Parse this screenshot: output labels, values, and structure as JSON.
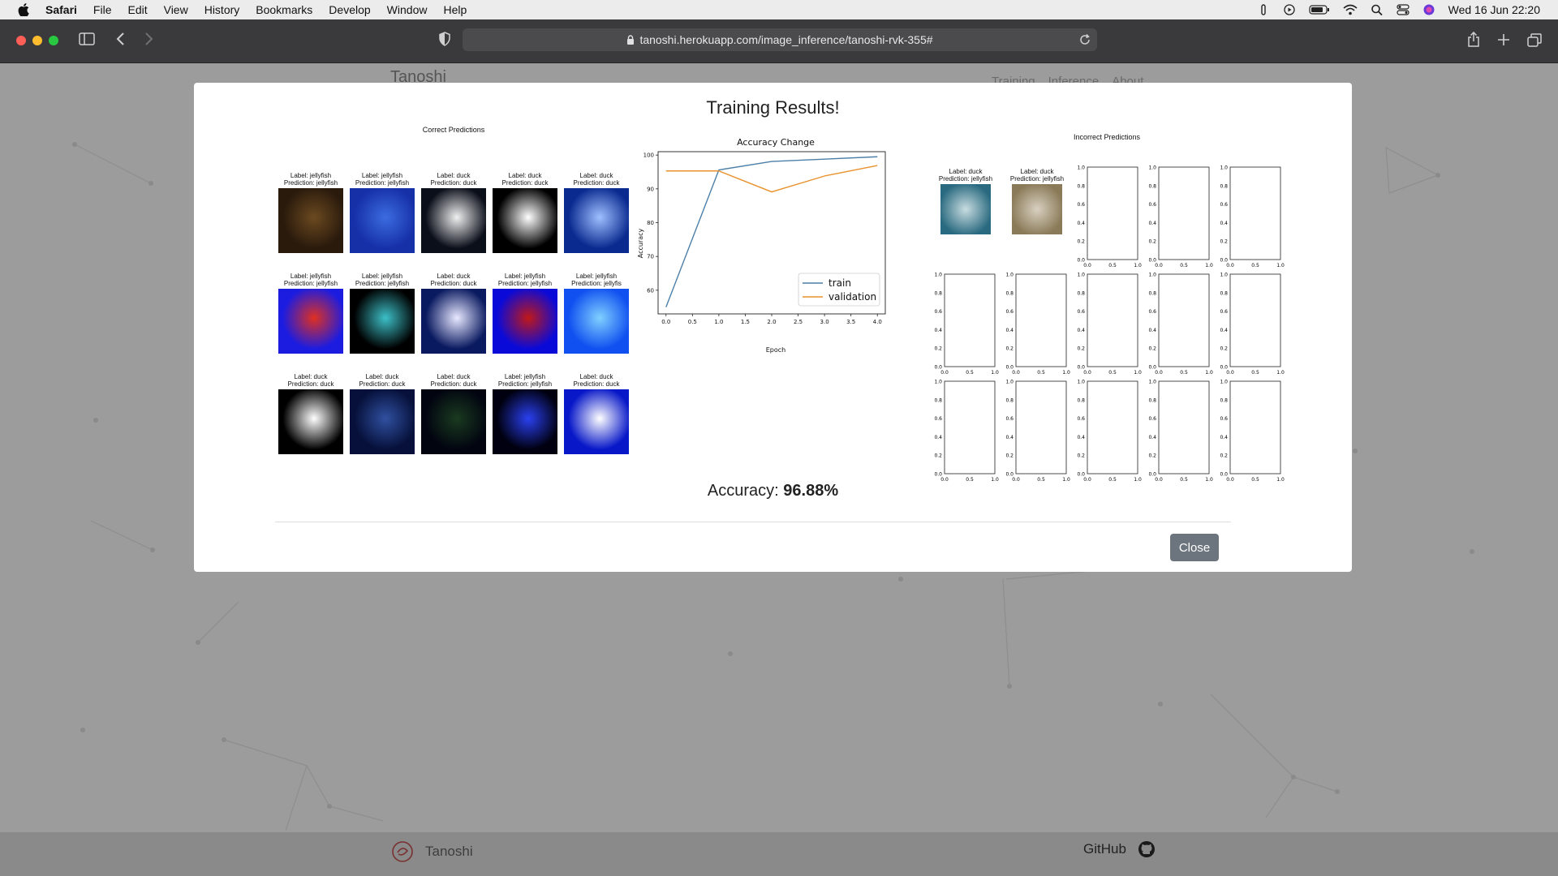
{
  "menubar": {
    "app": "Safari",
    "items": [
      "File",
      "Edit",
      "View",
      "History",
      "Bookmarks",
      "Develop",
      "Window",
      "Help"
    ],
    "datetime": "Wed 16 Jun  22:20"
  },
  "browser": {
    "url": "tanoshi.herokuapp.com/image_inference/tanoshi-rvk-355#"
  },
  "site": {
    "brand": "Tanoshi",
    "nav": [
      "Training",
      "Inference",
      "About"
    ],
    "footer_brand": "Tanoshi",
    "footer_github": "GitHub"
  },
  "modal": {
    "title": "Training Results!",
    "accuracy_label": "Accuracy:",
    "accuracy_value": "96.88%",
    "close_label": "Close"
  },
  "correct_panel": {
    "title": "Correct Predictions",
    "items": [
      {
        "label": "Label: jellyfish",
        "pred": "Prediction: jellyfish",
        "colors": [
          "#2a1a0c",
          "#6b4a20"
        ]
      },
      {
        "label": "Label: jellyfish",
        "pred": "Prediction: jellyfish",
        "colors": [
          "#1630a8",
          "#3c6ce0"
        ]
      },
      {
        "label": "Label: duck",
        "pred": "Prediction: duck",
        "colors": [
          "#0b0f1a",
          "#f0f0f0"
        ]
      },
      {
        "label": "Label: duck",
        "pred": "Prediction: duck",
        "colors": [
          "#000000",
          "#ffffff"
        ]
      },
      {
        "label": "Label: duck",
        "pred": "Prediction: duck",
        "colors": [
          "#0a2a90",
          "#9fc0ff"
        ]
      },
      {
        "label": "Label: jellyfish",
        "pred": "Prediction: jellyfish",
        "colors": [
          "#1c1ce0",
          "#e03020"
        ]
      },
      {
        "label": "Label: jellyfish",
        "pred": "Prediction: jellyfish",
        "colors": [
          "#000000",
          "#3cc0c8"
        ]
      },
      {
        "label": "Label: duck",
        "pred": "Prediction: duck",
        "colors": [
          "#0a1a60",
          "#e8e8ff"
        ]
      },
      {
        "label": "Label: jellyfish",
        "pred": "Prediction: jellyfish",
        "colors": [
          "#0a0ad8",
          "#c01818"
        ]
      },
      {
        "label": "Label: jellyfish",
        "pred": "Prediction: jellyfis",
        "colors": [
          "#1050f0",
          "#80d0ff"
        ]
      },
      {
        "label": "Label: duck",
        "pred": "Prediction: duck",
        "colors": [
          "#000000",
          "#ffffff"
        ]
      },
      {
        "label": "Label: duck",
        "pred": "Prediction: duck",
        "colors": [
          "#06103a",
          "#3050a0"
        ]
      },
      {
        "label": "Label: duck",
        "pred": "Prediction: duck",
        "colors": [
          "#020510",
          "#1a3a20"
        ]
      },
      {
        "label": "Label: jellyfish",
        "pred": "Prediction: jellyfish",
        "colors": [
          "#000010",
          "#2a40f0"
        ]
      },
      {
        "label": "Label: duck",
        "pred": "Prediction: duck",
        "colors": [
          "#0818c8",
          "#ffffff"
        ]
      }
    ]
  },
  "incorrect_panel": {
    "title": "Incorrect Predictions",
    "items": [
      {
        "label": "Label: duck",
        "pred": "Prediction: jellyfish",
        "colors": [
          "#2a6a80",
          "#c8dce0"
        ]
      },
      {
        "label": "Label: duck",
        "pred": "Prediction: jellyfish",
        "colors": [
          "#8a7a58",
          "#d8d0c0"
        ]
      }
    ],
    "y_ticks": [
      "0.0",
      "0.2",
      "0.4",
      "0.6",
      "0.8",
      "1.0"
    ],
    "x_ticks": [
      "0.0",
      "0.5",
      "1.0"
    ]
  },
  "chart_data": {
    "type": "line",
    "title": "Accuracy Change",
    "xlabel": "Epoch",
    "ylabel": "Accuracy",
    "x": [
      0,
      1,
      2,
      3,
      4
    ],
    "xlim": [
      -0.15,
      4.15
    ],
    "ylim": [
      53,
      101
    ],
    "x_ticks": [
      0.0,
      0.5,
      1.0,
      1.5,
      2.0,
      2.5,
      3.0,
      3.5,
      4.0
    ],
    "x_tick_labels": [
      "0.0",
      "0.5",
      "1.0",
      "1.5",
      "2.0",
      "2.5",
      "3.0",
      "3.5",
      "4.0"
    ],
    "y_ticks": [
      60,
      70,
      80,
      90,
      100
    ],
    "y_tick_labels": [
      "60",
      "70",
      "80",
      "90",
      "100"
    ],
    "legend_position": "lower-right",
    "series": [
      {
        "name": "train",
        "color": "#4c7fa8",
        "values": [
          55.0,
          95.6,
          98.1,
          98.8,
          99.5
        ]
      },
      {
        "name": "validation",
        "color": "#e8922c",
        "values": [
          95.3,
          95.3,
          89.1,
          93.8,
          96.9
        ]
      }
    ]
  }
}
